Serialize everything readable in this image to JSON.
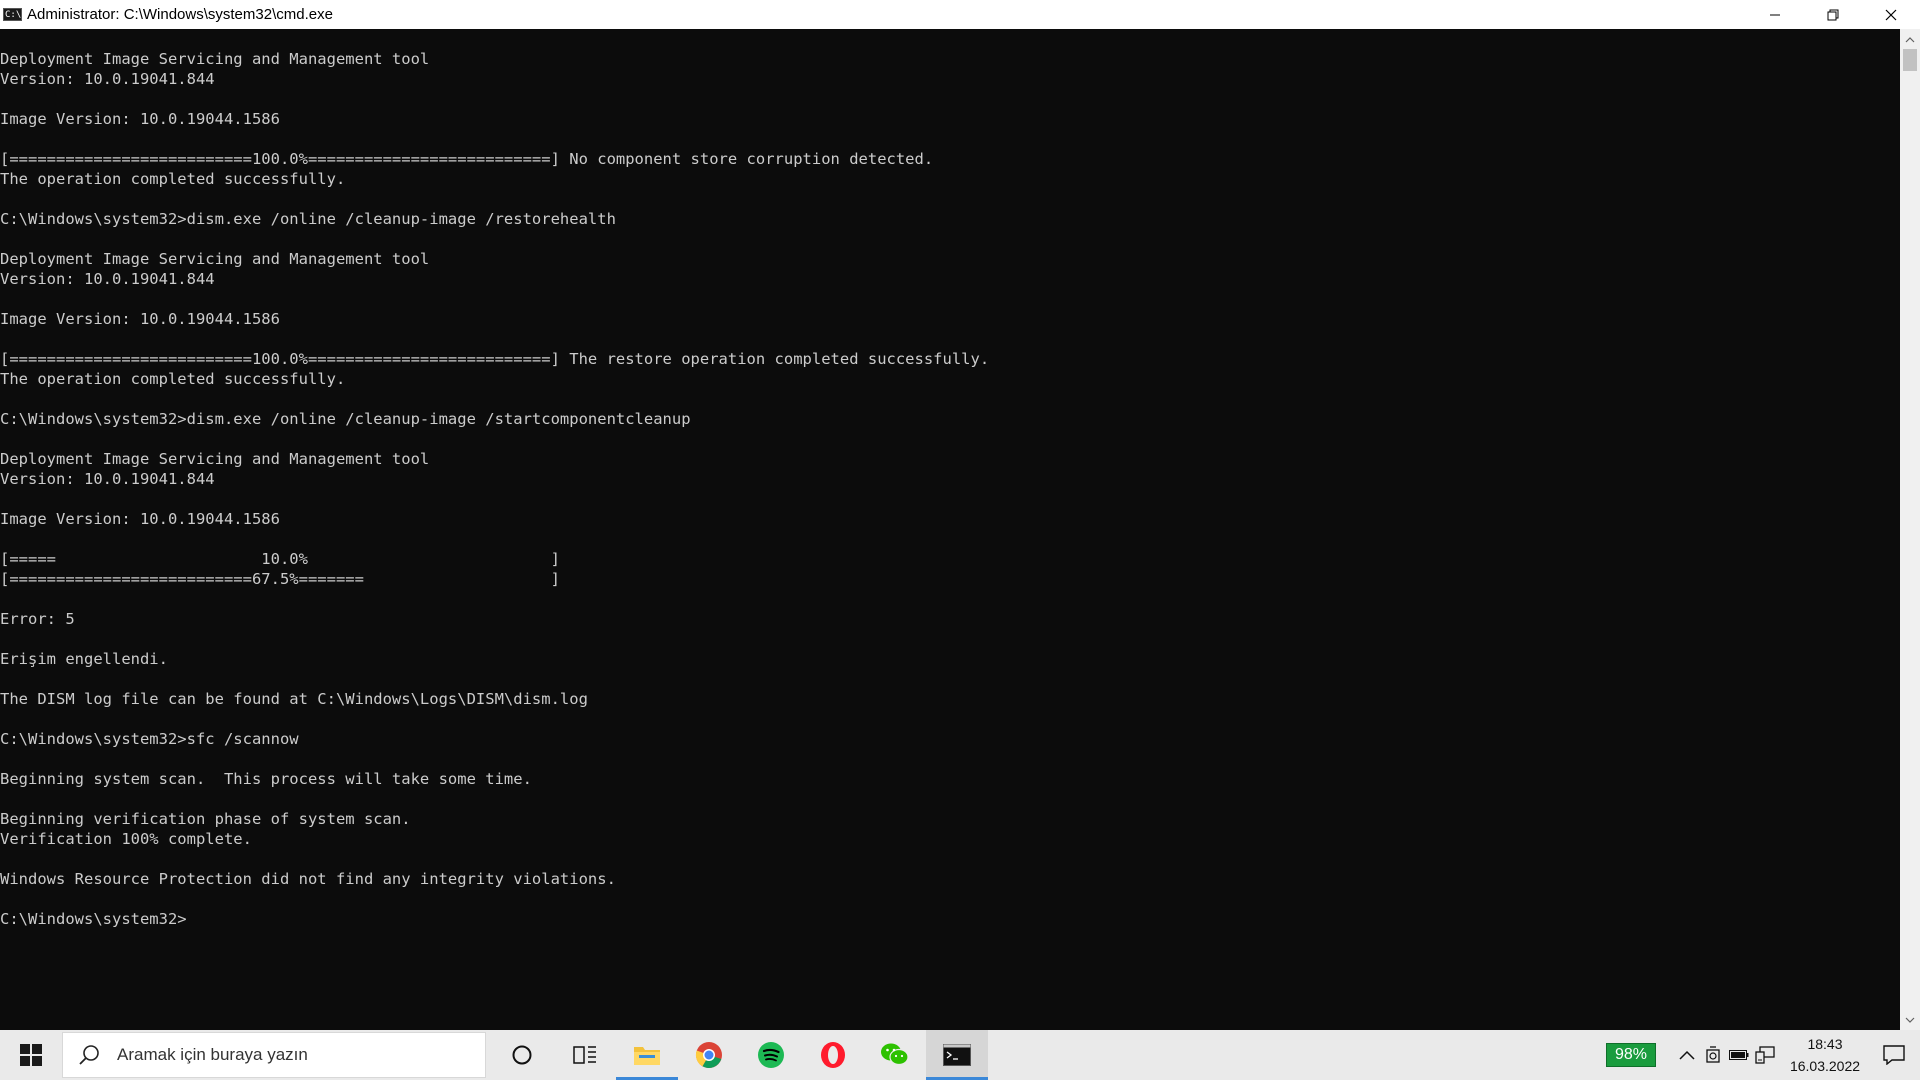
{
  "window": {
    "title": "Administrator: C:\\Windows\\system32\\cmd.exe",
    "icon_text": "C:\\"
  },
  "console": {
    "lines": [
      "",
      "Deployment Image Servicing and Management tool",
      "Version: 10.0.19041.844",
      "",
      "Image Version: 10.0.19044.1586",
      "",
      "[==========================100.0%==========================] No component store corruption detected.",
      "The operation completed successfully.",
      "",
      "C:\\Windows\\system32>dism.exe /online /cleanup-image /restorehealth",
      "",
      "Deployment Image Servicing and Management tool",
      "Version: 10.0.19041.844",
      "",
      "Image Version: 10.0.19044.1586",
      "",
      "[==========================100.0%==========================] The restore operation completed successfully.",
      "The operation completed successfully.",
      "",
      "C:\\Windows\\system32>dism.exe /online /cleanup-image /startcomponentcleanup",
      "",
      "Deployment Image Servicing and Management tool",
      "Version: 10.0.19041.844",
      "",
      "Image Version: 10.0.19044.1586",
      "",
      "[=====                      10.0%                          ]",
      "[==========================67.5%=======                    ]",
      "",
      "Error: 5",
      "",
      "Erişim engellendi.",
      "",
      "The DISM log file can be found at C:\\Windows\\Logs\\DISM\\dism.log",
      "",
      "C:\\Windows\\system32>sfc /scannow",
      "",
      "Beginning system scan.  This process will take some time.",
      "",
      "Beginning verification phase of system scan.",
      "Verification 100% complete.",
      "",
      "Windows Resource Protection did not find any integrity violations.",
      "",
      "C:\\Windows\\system32>"
    ]
  },
  "taskbar": {
    "search_placeholder": "Aramak için buraya yazın",
    "apps": [
      {
        "name": "cortana-button",
        "icon": "circle-icon"
      },
      {
        "name": "task-view-button",
        "icon": "task-view-icon"
      },
      {
        "name": "file-explorer-button",
        "icon": "folder-icon"
      },
      {
        "name": "chrome-button",
        "icon": "chrome-icon"
      },
      {
        "name": "spotify-button",
        "icon": "spotify-icon"
      },
      {
        "name": "opera-button",
        "icon": "opera-icon"
      },
      {
        "name": "wechat-button",
        "icon": "wechat-icon"
      },
      {
        "name": "cmd-button",
        "icon": "terminal-icon"
      }
    ],
    "battery_percent": "98%",
    "time": "18:43",
    "date": "16.03.2022"
  },
  "colors": {
    "console_bg": "#0c0c0c",
    "console_text": "#cccccc",
    "battery_badge": "#1a9c3e",
    "active_underline": "#3b88d8"
  }
}
